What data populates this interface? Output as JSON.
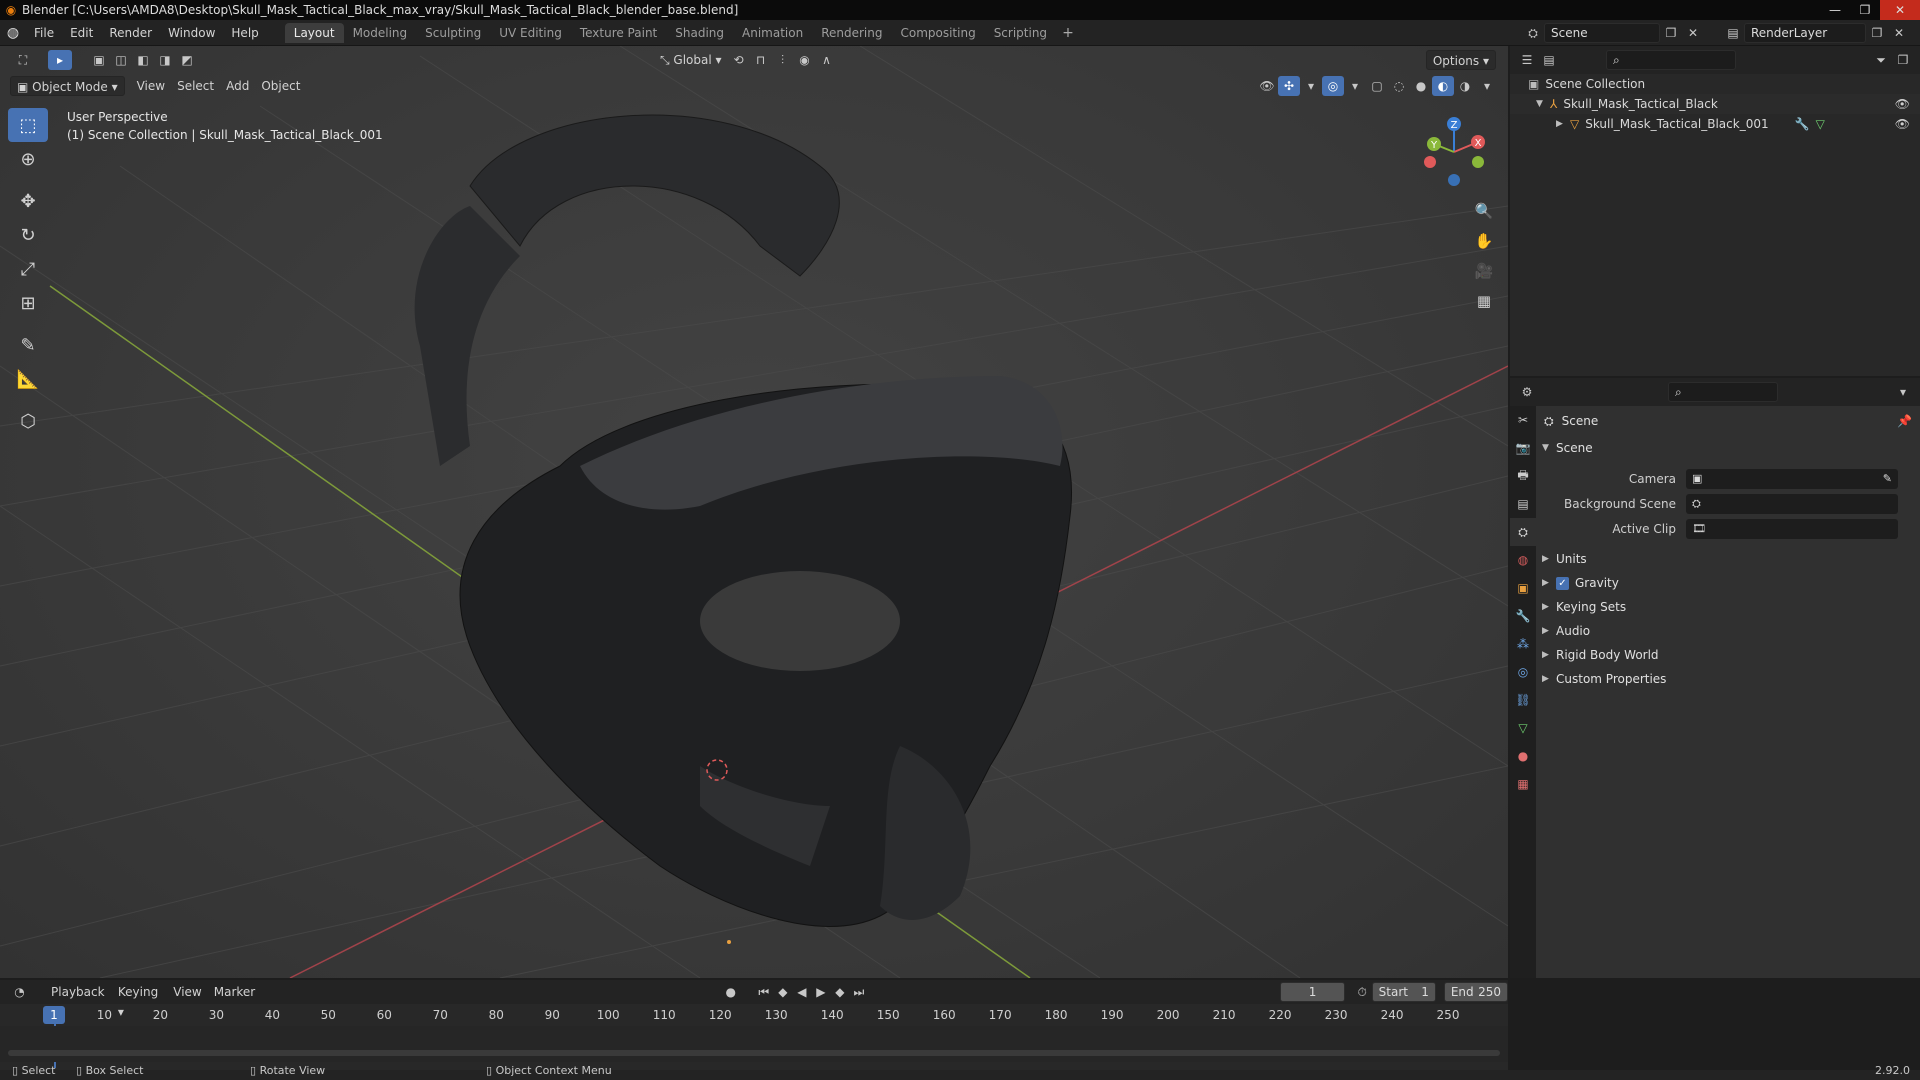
{
  "window": {
    "title": "Blender [C:\\Users\\AMDA8\\Desktop\\Skull_Mask_Tactical_Black_max_vray/Skull_Mask_Tactical_Black_blender_base.blend]"
  },
  "menu": [
    "File",
    "Edit",
    "Render",
    "Window",
    "Help"
  ],
  "workspaces": [
    "Layout",
    "Modeling",
    "Sculpting",
    "UV Editing",
    "Texture Paint",
    "Shading",
    "Animation",
    "Rendering",
    "Compositing",
    "Scripting"
  ],
  "active_workspace": "Layout",
  "scene_name": "Scene",
  "view_layer": "RenderLayer",
  "viewport": {
    "transform_orientation": "Global",
    "options_label": "Options",
    "mode": "Object Mode",
    "menus": [
      "View",
      "Select",
      "Add",
      "Object"
    ],
    "info_line1": "User Perspective",
    "info_line2": "(1) Scene Collection | Skull_Mask_Tactical_Black_001",
    "gizmo": {
      "z": "Z",
      "y": "Y",
      "x": "X"
    }
  },
  "outliner": {
    "root": "Scene Collection",
    "collection": "Skull_Mask_Tactical_Black",
    "object": "Skull_Mask_Tactical_Black_001"
  },
  "properties": {
    "header": "Scene",
    "panel": "Scene",
    "rows": [
      {
        "label": "Camera",
        "value": ""
      },
      {
        "label": "Background Scene",
        "value": ""
      },
      {
        "label": "Active Clip",
        "value": ""
      }
    ],
    "subpanels": [
      "Units",
      "Gravity",
      "Keying Sets",
      "Audio",
      "Rigid Body World",
      "Custom Properties"
    ]
  },
  "timeline": {
    "menus": [
      "Playback",
      "Keying",
      "View",
      "Marker"
    ],
    "current_frame": "1",
    "start_label": "Start",
    "start": "1",
    "end_label": "End",
    "end": "250",
    "ticks": [
      "10",
      "20",
      "30",
      "40",
      "50",
      "60",
      "70",
      "80",
      "90",
      "100",
      "110",
      "120",
      "130",
      "140",
      "150",
      "160",
      "170",
      "180",
      "190",
      "200",
      "210",
      "220",
      "230",
      "240",
      "250"
    ],
    "cursor_frame": "1"
  },
  "status": {
    "select": "Select",
    "box_select": "Box Select",
    "rotate_view": "Rotate View",
    "context_menu": "Object Context Menu",
    "version": "2.92.0"
  },
  "colors": {
    "accent": "#4772b3",
    "axis_x": "#e05a5a",
    "axis_y": "#8ab83a",
    "axis_z": "#3a7fd6"
  }
}
